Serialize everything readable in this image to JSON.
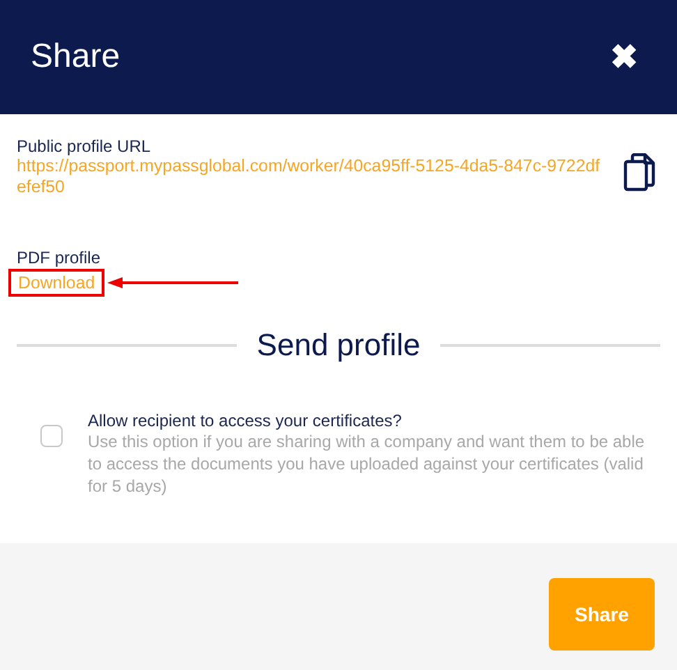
{
  "dialog": {
    "title": "Share",
    "close": "✖"
  },
  "public_url": {
    "label": "Public profile URL",
    "url": "https://passport.mypassglobal.com/worker/40ca95ff-5125-4da5-847c-9722dfefef50"
  },
  "pdf": {
    "label": "PDF profile",
    "link": "Download",
    "highlighted": true
  },
  "send_heading": "Send profile",
  "certificate_option": {
    "label": "Allow recipient to access your certificates?",
    "checked": false,
    "help": "Use this option if you are sharing with a company and want them to be able to access the documents you have uploaded against your certificates (valid for 5 days)"
  },
  "buttons": [
    "Share"
  ]
}
